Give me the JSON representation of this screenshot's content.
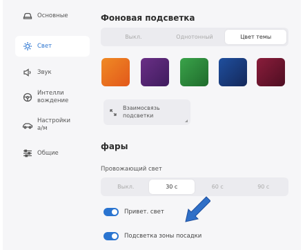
{
  "sidebar": {
    "items": [
      {
        "label": "Основные",
        "icon": "car-icon"
      },
      {
        "label": "Свет",
        "icon": "sun-icon",
        "active": true
      },
      {
        "label": "Звук",
        "icon": "speaker-icon"
      },
      {
        "label_line1": "Интелли",
        "label_line2": "вождение",
        "icon": "steering-wheel-icon"
      },
      {
        "label_line1": "Настройки",
        "label_line2": "а/м",
        "icon": "car-side-icon"
      },
      {
        "label": "Общие",
        "icon": "sliders-icon"
      }
    ]
  },
  "ambient": {
    "title": "Фоновая подсветка",
    "modes": [
      "Выкл.",
      "Однотонный",
      "Цвет темы"
    ],
    "selected_mode": "Цвет темы",
    "swatches": [
      {
        "name": "orange",
        "from": "#f08a24",
        "to": "#e2581b"
      },
      {
        "name": "purple",
        "from": "#6a2f86",
        "to": "#3f1c5e"
      },
      {
        "name": "green",
        "from": "#3aa34a",
        "to": "#1f6b2c"
      },
      {
        "name": "blue",
        "from": "#1f4f9e",
        "to": "#14285a"
      },
      {
        "name": "crimson",
        "from": "#8a1d3b",
        "to": "#4e0e22"
      }
    ],
    "sync_line1": "Взаимосвязь",
    "sync_line2": "подсветки"
  },
  "headlights": {
    "title": "фары",
    "follow_label": "Провожающий свет",
    "durations": [
      "Выкл.",
      "30 с",
      "60 с",
      "90 с"
    ],
    "selected_duration": "30 с",
    "toggles": [
      {
        "label": "Привет. свет",
        "on": true
      },
      {
        "label": "Подсветка зоны посадки",
        "on": true
      }
    ]
  },
  "colors": {
    "accent": "#2a74d0",
    "arrow": "#2f6fc7"
  }
}
